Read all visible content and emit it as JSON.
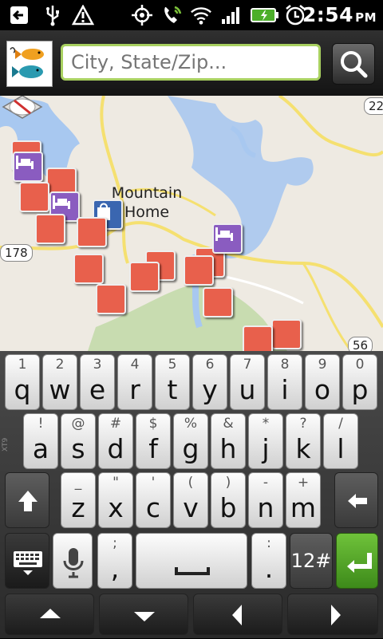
{
  "status_bar": {
    "time": "2:54",
    "ampm": "PM",
    "icons": [
      "back-icon",
      "usb-icon",
      "warning-icon",
      "gps-icon",
      "phone-icon",
      "wifi-icon",
      "signal-icon",
      "battery-icon",
      "alarm-icon"
    ]
  },
  "search": {
    "placeholder": "City, State/Zip..."
  },
  "map": {
    "city_label_line1": "Mountain",
    "city_label_line2": "Home",
    "route_badges": [
      "22",
      "178",
      "56"
    ],
    "colors": {
      "land": "#eeeae2",
      "water": "#a8c8f0",
      "road": "#f5e070",
      "park": "#c8dcb0"
    }
  },
  "keyboard": {
    "row1": [
      {
        "alt": "1",
        "main": "q"
      },
      {
        "alt": "2",
        "main": "w"
      },
      {
        "alt": "3",
        "main": "e"
      },
      {
        "alt": "4",
        "main": "r"
      },
      {
        "alt": "5",
        "main": "t"
      },
      {
        "alt": "6",
        "main": "y"
      },
      {
        "alt": "7",
        "main": "u"
      },
      {
        "alt": "8",
        "main": "i"
      },
      {
        "alt": "9",
        "main": "o"
      },
      {
        "alt": "0",
        "main": "p"
      }
    ],
    "row2": [
      {
        "alt": "!",
        "main": "a"
      },
      {
        "alt": "@",
        "main": "s"
      },
      {
        "alt": "#",
        "main": "d"
      },
      {
        "alt": "$",
        "main": "f"
      },
      {
        "alt": "%",
        "main": "g"
      },
      {
        "alt": "&",
        "main": "h"
      },
      {
        "alt": "*",
        "main": "j"
      },
      {
        "alt": "?",
        "main": "k"
      },
      {
        "alt": "/",
        "main": "l"
      }
    ],
    "row3": [
      {
        "alt": "_",
        "main": "z"
      },
      {
        "alt": "\"",
        "main": "x"
      },
      {
        "alt": "'",
        "main": "c"
      },
      {
        "alt": "(",
        "main": "v"
      },
      {
        "alt": ")",
        "main": "b"
      },
      {
        "alt": "-",
        "main": "n"
      },
      {
        "alt": "+",
        "main": "m"
      }
    ],
    "row4": {
      "comma_alt": ";",
      "comma": ",",
      "period_alt": ":",
      "period": ".",
      "symbols": "12#"
    },
    "side_label": "XT9"
  }
}
